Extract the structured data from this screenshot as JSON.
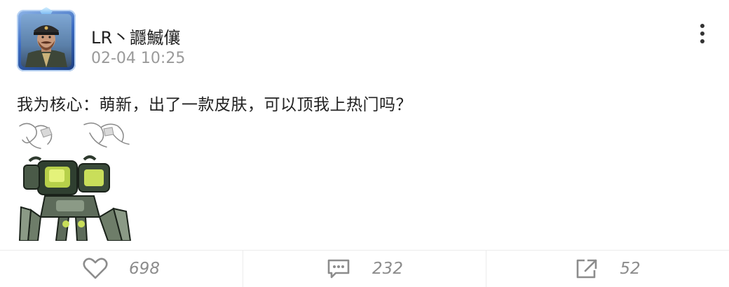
{
  "post": {
    "username": "LR丶讔鰄儴",
    "timestamp": "02-04 10:25",
    "body": "我为核心：萌新，出了一款皮肤，可以顶我上热门吗？"
  },
  "stats": {
    "likes": "698",
    "comments": "232",
    "shares": "52"
  },
  "icons": {
    "menu": "more-vertical-icon",
    "like": "heart-icon",
    "comment": "comment-icon",
    "share": "share-icon"
  },
  "colors": {
    "text_primary": "#222222",
    "text_secondary": "#9a9a9a",
    "counter": "#8c8c8c",
    "avatar_frame": "#3c6cc2"
  }
}
